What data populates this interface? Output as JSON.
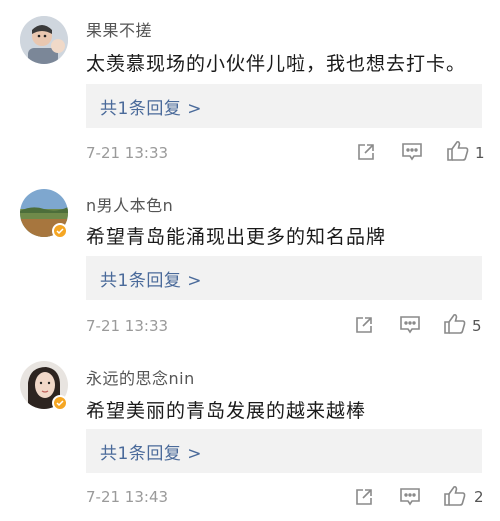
{
  "comments": [
    {
      "username": "果果不搓",
      "text": "太羡慕现场的小伙伴儿啦，我也想去打卡。",
      "reply_label": "共1条回复 >",
      "timestamp": "7-21 13:33",
      "likes": "1",
      "verified": false,
      "avatar_icon": "child-photo-avatar"
    },
    {
      "username": "n男人本色n",
      "text": "希望青岛能涌现出更多的知名品牌",
      "reply_label": "共1条回复 >",
      "timestamp": "7-21 13:33",
      "likes": "5",
      "verified": true,
      "avatar_icon": "landscape-photo-avatar"
    },
    {
      "username": "永远的思念nin",
      "text": "希望美丽的青岛发展的越来越棒",
      "reply_label": "共1条回复 >",
      "timestamp": "7-21 13:43",
      "likes": "2",
      "verified": true,
      "avatar_icon": "woman-photo-avatar"
    }
  ],
  "colors": {
    "reply_link": "#4a6a9a",
    "reply_bg": "#f2f2f2",
    "verified_badge": "#f5a623",
    "icon_gray": "#8a8a8a"
  }
}
